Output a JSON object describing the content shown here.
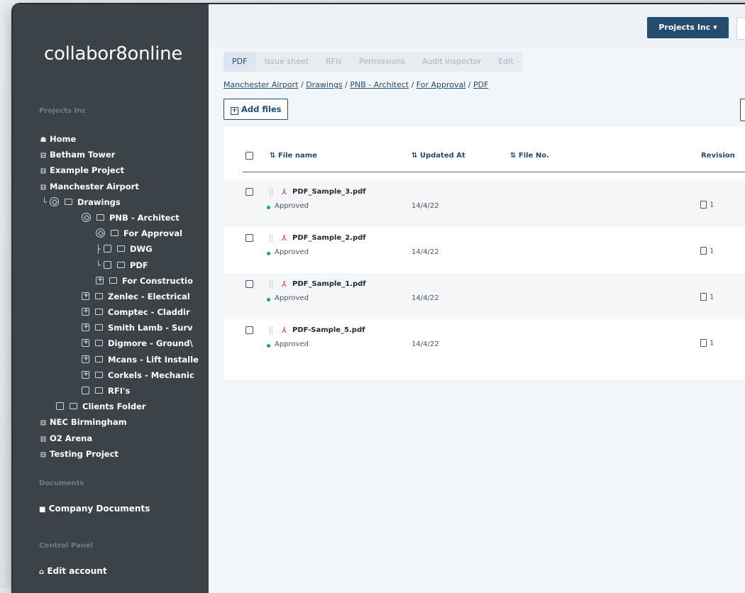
{
  "app": {
    "logo": "collabor8online"
  },
  "header": {
    "org_button": "Projects Inc"
  },
  "sidebar": {
    "org_label": "Projects Inc",
    "tree": [
      {
        "label": "Home"
      },
      {
        "label": "Betham Tower"
      },
      {
        "label": "Example Project"
      },
      {
        "label": "Manchester Airport"
      },
      {
        "label": "Drawings"
      },
      {
        "label": "PNB - Architect"
      },
      {
        "label": "For Approval"
      },
      {
        "label": "DWG"
      },
      {
        "label": "PDF"
      },
      {
        "label": "For Constructio"
      },
      {
        "label": "Zenlec - Electrical"
      },
      {
        "label": "Comptec - Claddir"
      },
      {
        "label": "Smith Lamb - Surv"
      },
      {
        "label": "Digmore - Ground\\"
      },
      {
        "label": "Mcans - Lift Installe"
      },
      {
        "label": "Corkels - Mechanic"
      },
      {
        "label": "RFI's"
      },
      {
        "label": "Clients Folder"
      },
      {
        "label": "NEC Birmingham"
      },
      {
        "label": "O2 Arena"
      },
      {
        "label": "Testing Project"
      }
    ],
    "documents_label": "Documents",
    "company_documents": "Company Documents",
    "control_panel_label": "Control Panel",
    "edit_account": "Edit account"
  },
  "tabs": [
    {
      "label": "PDF"
    },
    {
      "label": "Issue sheet"
    },
    {
      "label": "RFIs"
    },
    {
      "label": "Permissions"
    },
    {
      "label": "Audit inspector"
    },
    {
      "label": "Edit"
    }
  ],
  "breadcrumb": [
    "Manchester Airport",
    "Drawings",
    "PNB - Architect",
    "For Approval",
    "PDF"
  ],
  "actions": {
    "add_files": "Add files"
  },
  "table": {
    "headers": {
      "file_name": "File name",
      "updated_at": "Updated At",
      "file_no": "File No.",
      "revision": "Revision"
    },
    "rows": [
      {
        "name": "PDF_Sample_3.pdf",
        "status": "Approved",
        "date": "14/4/22",
        "revision": "1"
      },
      {
        "name": "PDF_Sample_2.pdf",
        "status": "Approved",
        "date": "14/4/22",
        "revision": "1"
      },
      {
        "name": "PDF_Sample_1.pdf",
        "status": "Approved",
        "date": "14/4/22",
        "revision": "1"
      },
      {
        "name": "PDF-Sample_5.pdf",
        "status": "Approved",
        "date": "14/4/22",
        "revision": "1"
      }
    ]
  },
  "colors": {
    "primary": "#234c70",
    "sidebar": "#3c4348",
    "approved": "#27a844"
  }
}
